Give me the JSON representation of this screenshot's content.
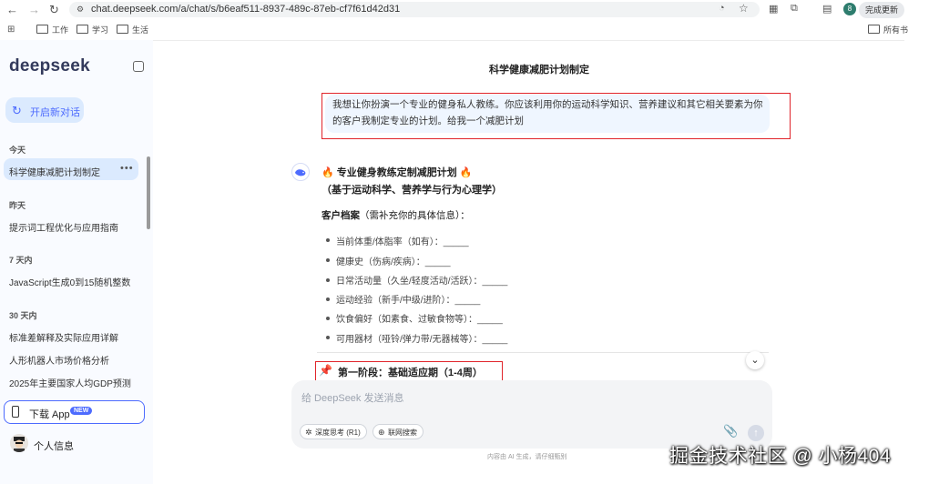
{
  "browser": {
    "url": "chat.deepseek.com/a/chat/s/b6eaf511-8937-489c-87eb-cf7f61d42d31",
    "bookmarks": [
      "工作",
      "学习",
      "生活"
    ],
    "bookmarks_right": "所有书",
    "update_button": "完成更新",
    "profile_initial": "8"
  },
  "sidebar": {
    "logo": "deepseek",
    "new_chat": "开启新对话",
    "sections": [
      {
        "label": "今天",
        "items": [
          "科学健康减肥计划制定"
        ]
      },
      {
        "label": "昨天",
        "items": [
          "提示词工程优化与应用指南"
        ]
      },
      {
        "label": "7 天内",
        "items": [
          "JavaScript生成0到15随机整数"
        ]
      },
      {
        "label": "30 天内",
        "items": [
          "标准差解释及实际应用详解",
          "人形机器人市场价格分析",
          "2025年主要国家人均GDP预测"
        ]
      }
    ],
    "download_app": "下载 App",
    "new_badge": "NEW",
    "profile": "个人信息"
  },
  "chat": {
    "title": "科学健康减肥计划制定",
    "user_message": "我想让你扮演一个专业的健身私人教练。你应该利用你的运动科学知识、营养建议和其它相关要素为你的客户我制定专业的计划。给我一个减肥计划",
    "response": {
      "heading": "🔥 专业健身教练定制减肥计划 🔥",
      "subheading": "（基于运动科学、营养学与行为心理学）",
      "profile_label": "客户档案",
      "profile_hint": "（需补充你的具体信息）：",
      "items": [
        "当前体重/体脂率（如有）：_____",
        "健康史（伤病/疾病）：_____",
        "日常活动量（久坐/轻度活动/活跃）：_____",
        "运动经验（新手/中级/进阶）：_____",
        "饮食偏好（如素食、过敏食物等）：_____",
        "可用器材（哑铃/弹力带/无器械等）：_____"
      ],
      "stage": "第一阶段：基础适应期（1-4周）"
    },
    "input_placeholder": "给 DeepSeek 发送消息",
    "deep_think": "深度思考 (R1)",
    "web_search": "联网搜索",
    "footer": "内容由 AI 生成，请仔细甄别"
  },
  "watermark": "掘金技术社区 @ 小杨404"
}
